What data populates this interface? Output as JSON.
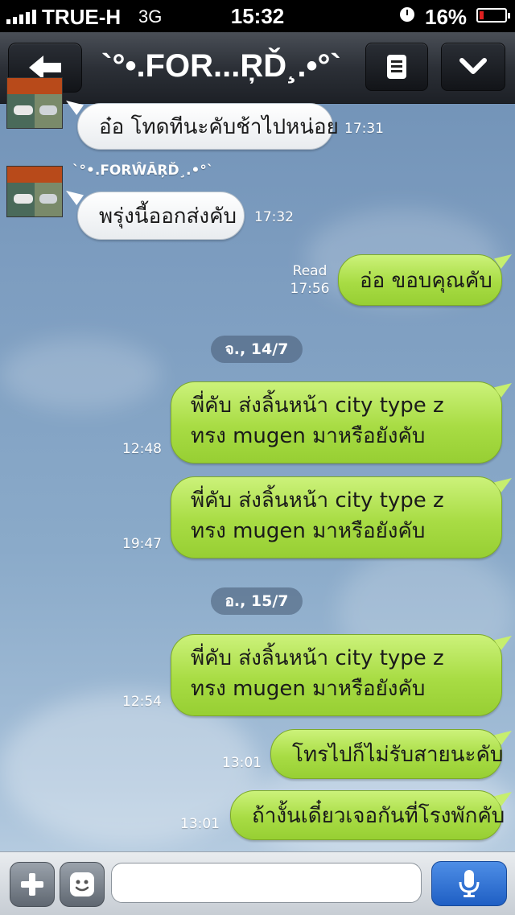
{
  "status_bar": {
    "carrier": "TRUE-H",
    "network": "3G",
    "time": "15:32",
    "battery": "16%",
    "battery_level": 0.16
  },
  "header": {
    "title": "`°•.FOR...ŖĎ¸.•°`",
    "back_icon": "back-arrow-icon",
    "menu_icon": "list-menu-icon",
    "dropdown_icon": "chevron-down-icon"
  },
  "chat": {
    "sender_name": "`°•.FORŴĀŖĎ¸.•°`",
    "messages": [
      {
        "text": "อ๋อ โทดทีนะคับช้าไปหน่อย",
        "time": "17:31",
        "direction": "in"
      },
      {
        "text": "พรุ่งนี้ออกส่งคับ",
        "time": "17:32",
        "direction": "in"
      },
      {
        "text": "อ่อ ขอบคุณคับ",
        "time": "17:56",
        "direction": "out",
        "status": "Read"
      },
      {
        "text": "พี่คับ ส่งลิ้นหน้า city type z ทรง mugen มาหรือยังคับ",
        "time": "12:48",
        "direction": "out"
      },
      {
        "text": "พี่คับ ส่งลิ้นหน้า city type z ทรง mugen มาหรือยังคับ",
        "time": "19:47",
        "direction": "out"
      },
      {
        "text": "พี่คับ ส่งลิ้นหน้า city type z ทรง mugen มาหรือยังคับ",
        "time": "12:54",
        "direction": "out"
      },
      {
        "text": "โทรไปก็ไม่รับสายนะคับ",
        "time": "13:01",
        "direction": "out"
      },
      {
        "text": "ถ้างั้นเดี๋ยวเจอกันที่โรงพักคับ",
        "time": "13:01",
        "direction": "out"
      }
    ],
    "date_separators": [
      "จ., 14/7",
      "อ., 15/7"
    ]
  },
  "input_bar": {
    "add_icon": "plus-icon",
    "sticker_icon": "smiley-icon",
    "placeholder": "",
    "mic_icon": "microphone-icon"
  },
  "colors": {
    "outgoing_bubble": "#a8dc44",
    "incoming_bubble": "#ffffff",
    "mic_button": "#2b6fd4"
  }
}
